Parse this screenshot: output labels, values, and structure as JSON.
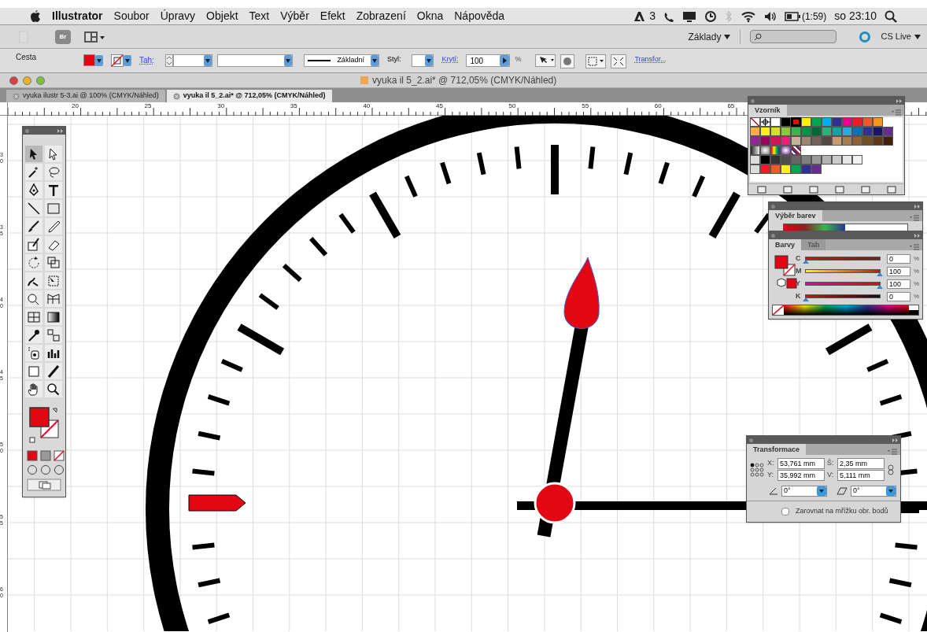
{
  "menu_bar": {
    "app_name": "Illustrator",
    "items": [
      "Soubor",
      "Úpravy",
      "Objekt",
      "Text",
      "Výběr",
      "Efekt",
      "Zobrazení",
      "Okna",
      "Nápověda"
    ],
    "status": {
      "notification_count": "3",
      "battery": "(1:59)",
      "clock": "so 23:10"
    }
  },
  "application_bar": {
    "bridge_button": "Br",
    "workspace": "Základy",
    "cs_live": "CS Live"
  },
  "control_bar": {
    "selection_type": "Cesta",
    "stroke_label": "Tah:",
    "brush_label": "Základní",
    "style_label": "Styl:",
    "opacity_label": "Krytí:",
    "opacity": "100",
    "opacity_unit": "%",
    "transform_link": "Transfor..."
  },
  "document": {
    "title": "vyuka il 5_2.ai* @ 712,05% (CMYK/Náhled)",
    "tabs": [
      {
        "label": "vyuka ilustr 5-3.ai @ 100% (CMYK/Náhled)",
        "selected": false
      },
      {
        "label": "vyuka il 5_2.ai* @ 712,05% (CMYK/Náhled)",
        "selected": true
      }
    ]
  },
  "rulers": {
    "horizontal": [
      "20",
      "25",
      "30",
      "35",
      "40",
      "45",
      "50",
      "55",
      "60",
      "65"
    ],
    "vertical": [
      "30",
      "35",
      "40",
      "45",
      "50",
      "55",
      "60"
    ]
  },
  "swatches_panel": {
    "title": "Vzorník",
    "rows": [
      [
        {
          "kind": "none",
          "selected": false
        },
        {
          "kind": "registration",
          "selected": false
        },
        {
          "kind": "color",
          "color": "#ffffff",
          "selected": false
        },
        {
          "kind": "color",
          "color": "#000000",
          "selected": false
        },
        {
          "kind": "color",
          "color": "#e30613",
          "selected": true
        },
        {
          "kind": "color",
          "color": "#fff200",
          "selected": false
        },
        {
          "kind": "color",
          "color": "#00a651",
          "selected": false
        },
        {
          "kind": "color",
          "color": "#00aeef",
          "selected": false
        },
        {
          "kind": "color",
          "color": "#2e3192",
          "selected": false
        },
        {
          "kind": "color",
          "color": "#ec008c",
          "selected": false
        },
        {
          "kind": "color",
          "color": "#ed1c24",
          "selected": false
        },
        {
          "kind": "color",
          "color": "#f15a24",
          "selected": false
        },
        {
          "kind": "color",
          "color": "#f7941d",
          "selected": false
        }
      ],
      [
        {
          "kind": "color",
          "color": "#fbb03b",
          "selected": false
        },
        {
          "kind": "color",
          "color": "#fcee21",
          "selected": false
        },
        {
          "kind": "color",
          "color": "#d9e021",
          "selected": false
        },
        {
          "kind": "color",
          "color": "#8cc63f",
          "selected": false
        },
        {
          "kind": "color",
          "color": "#39b54a",
          "selected": false
        },
        {
          "kind": "color",
          "color": "#009245",
          "selected": false
        },
        {
          "kind": "color",
          "color": "#006837",
          "selected": false
        },
        {
          "kind": "color",
          "color": "#22b573",
          "selected": false
        },
        {
          "kind": "color",
          "color": "#00a99d",
          "selected": false
        },
        {
          "kind": "color",
          "color": "#29abe2",
          "selected": false
        },
        {
          "kind": "color",
          "color": "#0071bc",
          "selected": false
        },
        {
          "kind": "color",
          "color": "#2e3192",
          "selected": false
        },
        {
          "kind": "color",
          "color": "#1b1464",
          "selected": false
        },
        {
          "kind": "color",
          "color": "#662d91",
          "selected": false
        }
      ],
      [
        {
          "kind": "color",
          "color": "#93278f",
          "selected": false
        },
        {
          "kind": "color",
          "color": "#9e005d",
          "selected": false
        },
        {
          "kind": "color",
          "color": "#d4145a",
          "selected": false
        },
        {
          "kind": "color",
          "color": "#ed1e79",
          "selected": false
        },
        {
          "kind": "color",
          "color": "#c7b299",
          "selected": false
        },
        {
          "kind": "color",
          "color": "#998675",
          "selected": false
        },
        {
          "kind": "color",
          "color": "#736357",
          "selected": false
        },
        {
          "kind": "color",
          "color": "#534741",
          "selected": false
        },
        {
          "kind": "color",
          "color": "#c69c6d",
          "selected": false
        },
        {
          "kind": "color",
          "color": "#a67c52",
          "selected": false
        },
        {
          "kind": "color",
          "color": "#8c6239",
          "selected": false
        },
        {
          "kind": "color",
          "color": "#754c24",
          "selected": false
        },
        {
          "kind": "color",
          "color": "#603813",
          "selected": false
        },
        {
          "kind": "color",
          "color": "#42210b",
          "selected": false
        }
      ],
      [
        {
          "kind": "gradient",
          "selected": false
        },
        {
          "kind": "gradient",
          "selected": false
        },
        {
          "kind": "gradient",
          "selected": false
        },
        {
          "kind": "gradient",
          "selected": false
        },
        {
          "kind": "pattern",
          "selected": false
        }
      ],
      [
        {
          "kind": "folder",
          "selected": false
        },
        {
          "kind": "color",
          "color": "#000000",
          "selected": false
        },
        {
          "kind": "color",
          "color": "#333333",
          "selected": false
        },
        {
          "kind": "color",
          "color": "#4d4d4d",
          "selected": false
        },
        {
          "kind": "color",
          "color": "#666666",
          "selected": false
        },
        {
          "kind": "color",
          "color": "#808080",
          "selected": false
        },
        {
          "kind": "color",
          "color": "#999999",
          "selected": false
        },
        {
          "kind": "color",
          "color": "#b3b3b3",
          "selected": false
        },
        {
          "kind": "color",
          "color": "#cccccc",
          "selected": false
        },
        {
          "kind": "color",
          "color": "#e6e6e6",
          "selected": false
        },
        {
          "kind": "color",
          "color": "#f2f2f2",
          "selected": false
        }
      ],
      [
        {
          "kind": "folder",
          "selected": false
        },
        {
          "kind": "color",
          "color": "#ed1c24",
          "selected": false
        },
        {
          "kind": "color",
          "color": "#f15a24",
          "selected": false
        },
        {
          "kind": "color",
          "color": "#fcee21",
          "selected": false
        },
        {
          "kind": "color",
          "color": "#00a651",
          "selected": false
        },
        {
          "kind": "color",
          "color": "#2e3192",
          "selected": false
        },
        {
          "kind": "color",
          "color": "#662d91",
          "selected": false
        }
      ]
    ]
  },
  "color_guide_panel": {
    "title": "Výběr barev"
  },
  "color_panel": {
    "tabs": [
      {
        "label": "Barvy",
        "selected": true
      },
      {
        "label": "Tah",
        "selected": false
      }
    ],
    "channels": [
      {
        "label": "C",
        "value": "0",
        "unit": "%",
        "level": 0
      },
      {
        "label": "M",
        "value": "100",
        "unit": "%",
        "level": 1
      },
      {
        "label": "Y",
        "value": "100",
        "unit": "%",
        "level": 1
      },
      {
        "label": "K",
        "value": "0",
        "unit": "%",
        "level": 0
      }
    ]
  },
  "transform_panel": {
    "title": "Transformace",
    "fields": [
      {
        "label": "X:",
        "value": "53,761 mm"
      },
      {
        "label": "Š:",
        "value": "2,35 mm"
      },
      {
        "label": "Y:",
        "value": "35,992 mm"
      },
      {
        "label": "V:",
        "value": "5,111 mm"
      }
    ],
    "rotate": "0°",
    "shear": "0°",
    "snap_checkbox": {
      "label": "Zarovnat na mřížku obr. bodů",
      "checked": false
    }
  }
}
